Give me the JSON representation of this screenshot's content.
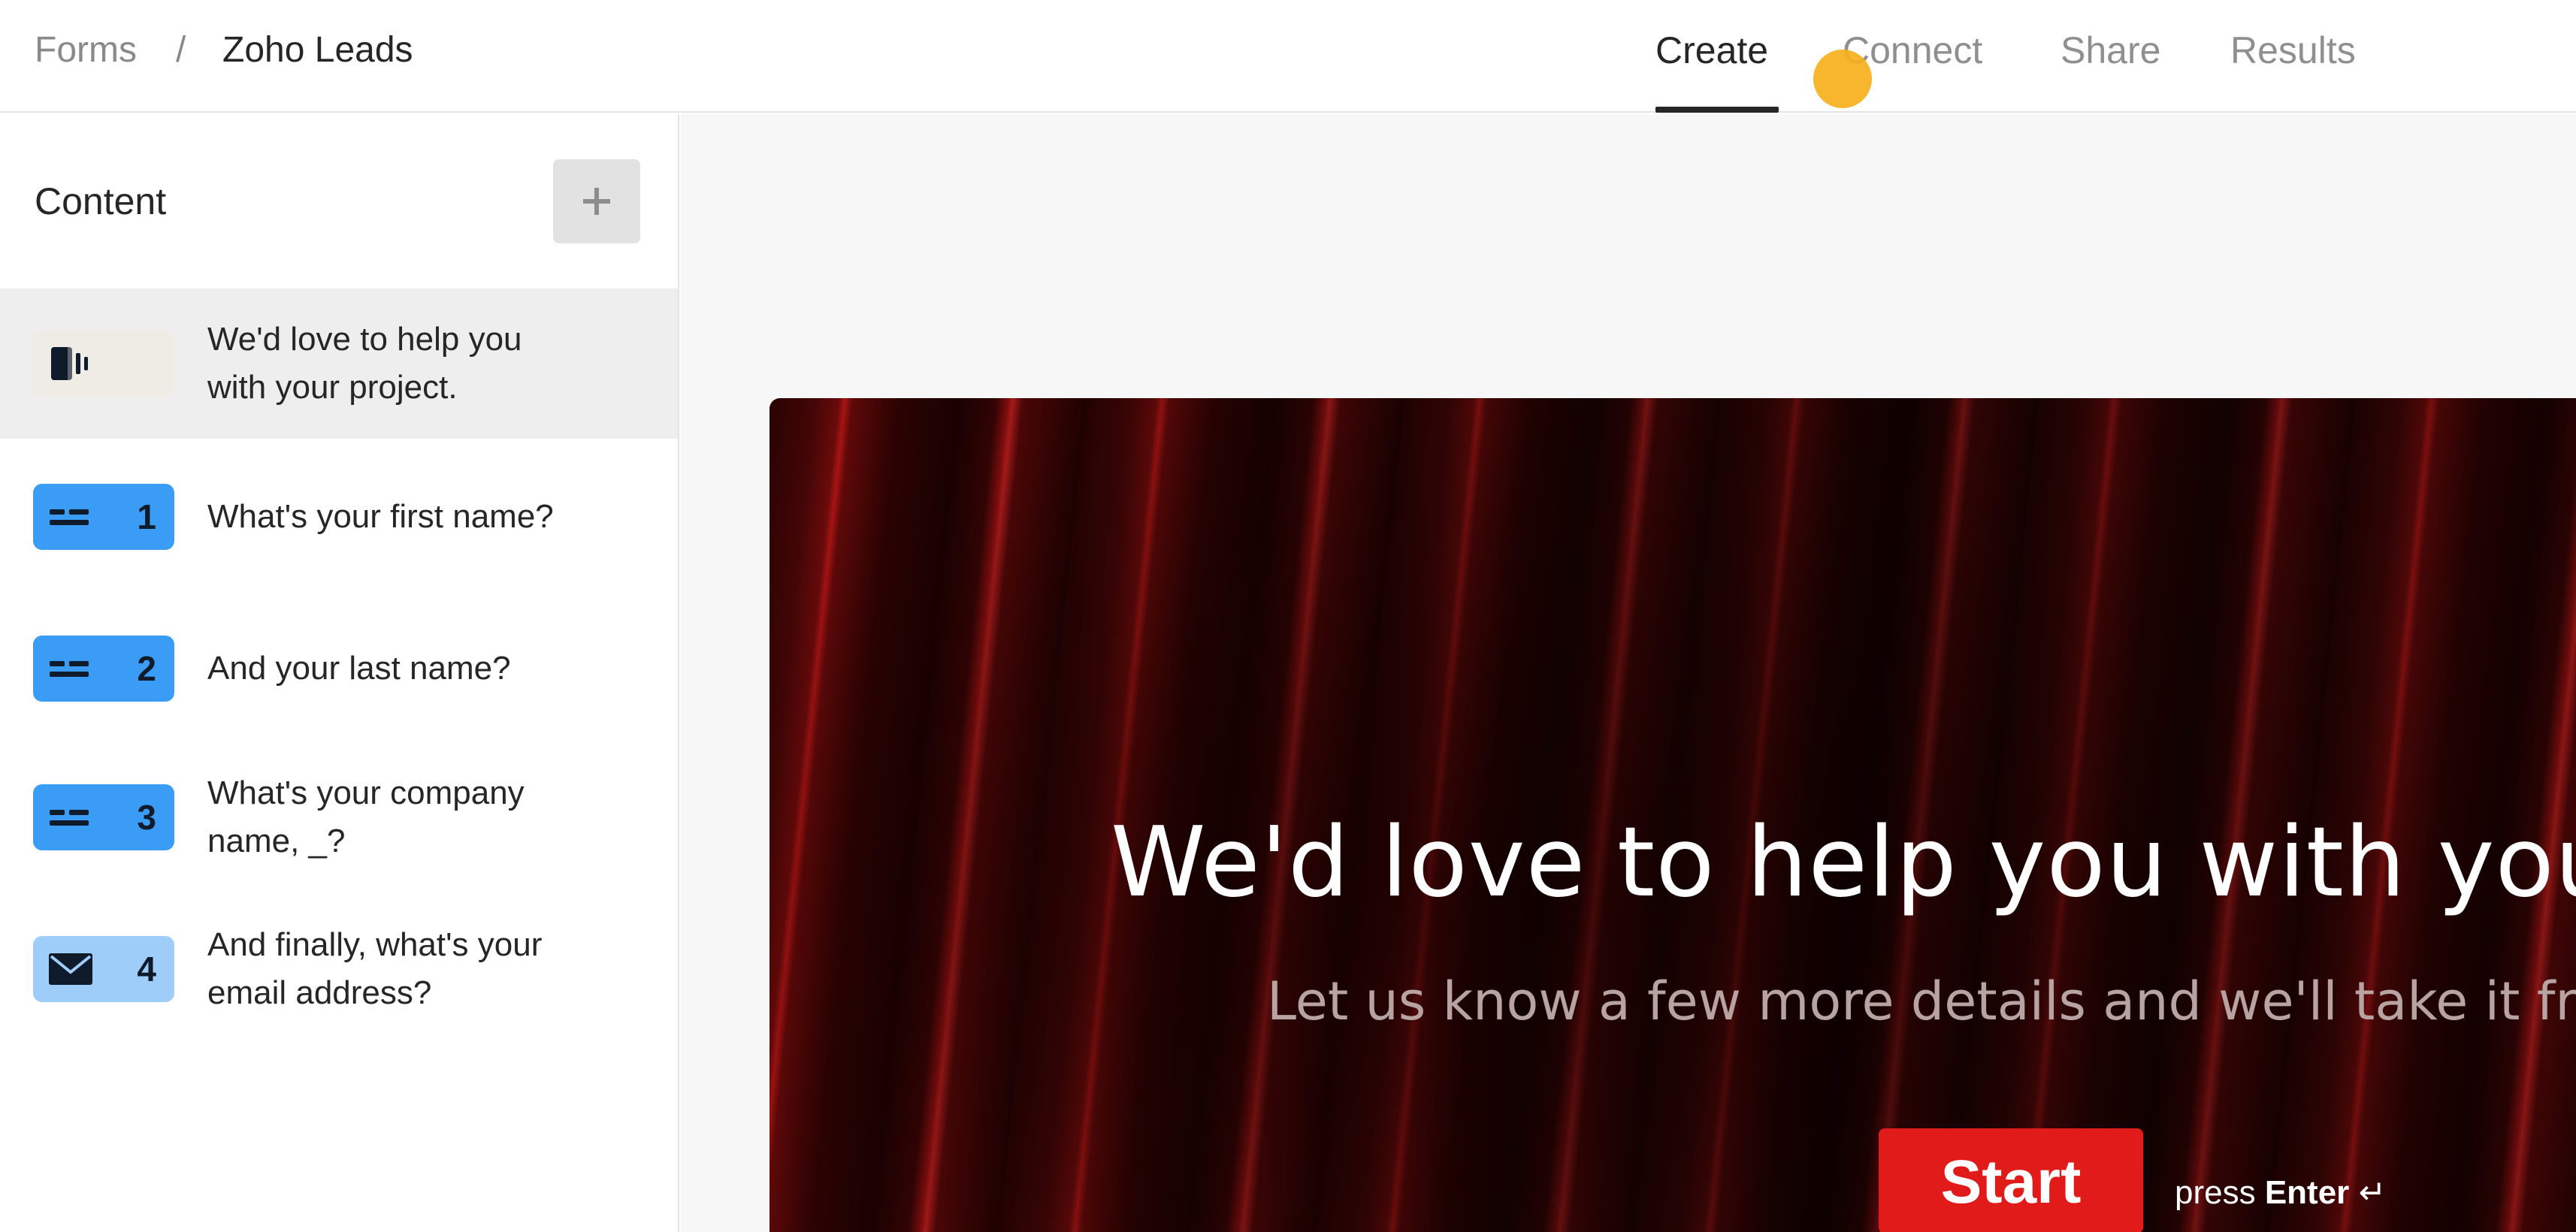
{
  "breadcrumb": {
    "root": "Forms",
    "separator": "/",
    "current": "Zoho Leads"
  },
  "tabs": [
    {
      "label": "Create",
      "active": true
    },
    {
      "label": "Connect",
      "active": false
    },
    {
      "label": "Share",
      "active": false
    },
    {
      "label": "Results",
      "active": false
    }
  ],
  "sidebar": {
    "title": "Content",
    "add_icon": "plus-icon",
    "items": [
      {
        "kind": "welcome-screen",
        "icon": "welcome-screen-icon",
        "number": "",
        "line1": "We'd love to help you",
        "line2": "with your project.",
        "selected": true
      },
      {
        "kind": "short-text",
        "icon": "short-text-icon",
        "number": "1",
        "line1": "What's your first name?",
        "line2": "",
        "selected": false
      },
      {
        "kind": "short-text",
        "icon": "short-text-icon",
        "number": "2",
        "line1": "And your last name?",
        "line2": "",
        "selected": false
      },
      {
        "kind": "short-text",
        "icon": "short-text-icon",
        "number": "3",
        "line1": "What's your company",
        "line2": "name, _?",
        "selected": false
      },
      {
        "kind": "email",
        "icon": "envelope-icon",
        "number": "4",
        "line1": "And finally, what's your",
        "line2": "email address?",
        "selected": false
      }
    ]
  },
  "preview": {
    "title": "We'd love to help you with your p",
    "subtitle": "Let us know a few more details and we'll take it from",
    "start_label": "Start",
    "hint_prefix": "press",
    "hint_key": "Enter",
    "hint_icon": "↵"
  },
  "colors": {
    "accent_blue": "#3b9cf6",
    "email_badge": "#9fcdfa",
    "start_red": "#e11a1a",
    "cursor_marker": "#f7b01c"
  }
}
